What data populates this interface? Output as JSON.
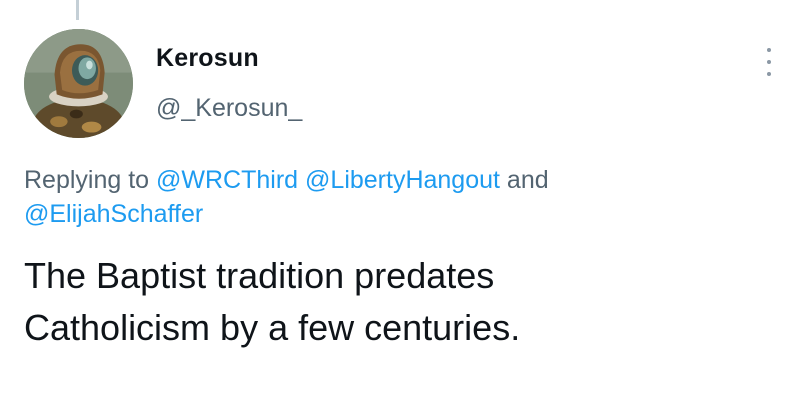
{
  "tweet": {
    "author": {
      "display_name": "Kerosun",
      "handle": "@_Kerosun_"
    },
    "more_icon": "more-vertical-icon",
    "reply": {
      "prefix": "Replying to",
      "mentions": [
        "@WRCThird",
        "@LibertyHangout",
        "@ElijahSchaffer"
      ],
      "conjunction": "and"
    },
    "text_lines": [
      "The Baptist tradition predates",
      "Catholicism by a few centuries."
    ]
  },
  "colors": {
    "link": "#1d9bf0",
    "secondary_text": "#536471",
    "primary_text": "#0f1419",
    "thread_line": "#c4cfd6"
  }
}
